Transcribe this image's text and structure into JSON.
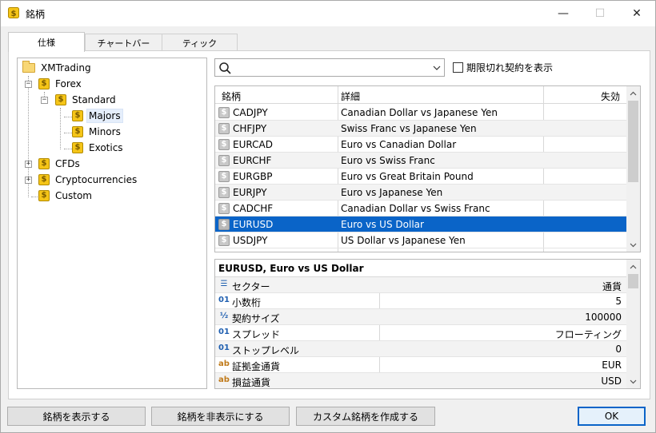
{
  "window": {
    "title": "銘柄",
    "minimize": "—",
    "maximize": "☐",
    "close": "✕"
  },
  "tabs": [
    {
      "label": "仕様",
      "active": true
    },
    {
      "label": "チャートバー",
      "active": false
    },
    {
      "label": "ティック",
      "active": false
    }
  ],
  "tree": {
    "root": "XMTrading",
    "forex": "Forex",
    "standard": "Standard",
    "majors": "Majors",
    "minors": "Minors",
    "exotics": "Exotics",
    "cfds": "CFDs",
    "crypto": "Cryptocurrencies",
    "custom": "Custom",
    "expanded_glyph": "−",
    "collapsed_glyph": "+"
  },
  "search": {
    "value": "",
    "placeholder": ""
  },
  "show_expired": {
    "label": "期限切れ契約を表示",
    "checked": false
  },
  "symbols_table": {
    "headers": [
      "銘柄",
      "詳細",
      "失効"
    ],
    "icon_glyph": "$",
    "rows": [
      {
        "symbol": "CADJPY",
        "description": "Canadian Dollar vs Japanese Yen",
        "expiration": ""
      },
      {
        "symbol": "CHFJPY",
        "description": "Swiss Franc vs Japanese Yen",
        "expiration": ""
      },
      {
        "symbol": "EURCAD",
        "description": "Euro vs Canadian Dollar",
        "expiration": ""
      },
      {
        "symbol": "EURCHF",
        "description": "Euro vs Swiss Franc",
        "expiration": ""
      },
      {
        "symbol": "EURGBP",
        "description": "Euro vs Great Britain Pound",
        "expiration": ""
      },
      {
        "symbol": "EURJPY",
        "description": "Euro vs Japanese Yen",
        "expiration": ""
      },
      {
        "symbol": "CADCHF",
        "description": "Canadian Dollar vs Swiss Franc",
        "expiration": ""
      },
      {
        "symbol": "EURUSD",
        "description": "Euro vs US Dollar",
        "expiration": ""
      },
      {
        "symbol": "USDJPY",
        "description": "US Dollar vs Japanese Yen",
        "expiration": ""
      }
    ],
    "selected_symbol": "EURUSD"
  },
  "details": {
    "title": "EURUSD, Euro vs US Dollar",
    "rows": [
      {
        "icon": "sector-icon",
        "glyph": "☰",
        "name": "セクター",
        "value": "通貨"
      },
      {
        "icon": "digits-icon",
        "glyph": "01",
        "name": "小数桁",
        "value": "5"
      },
      {
        "icon": "fraction-icon",
        "glyph": "½",
        "name": "契約サイズ",
        "value": "100000"
      },
      {
        "icon": "digits-icon",
        "glyph": "01",
        "name": "スプレッド",
        "value": "フローティング"
      },
      {
        "icon": "digits-icon",
        "glyph": "01",
        "name": "ストップレベル",
        "value": "0"
      },
      {
        "icon": "text-icon",
        "glyph": "ab",
        "name": "証拠金通貨",
        "value": "EUR"
      },
      {
        "icon": "text-icon",
        "glyph": "ab",
        "name": "損益通貨",
        "value": "USD"
      }
    ]
  },
  "buttons": {
    "show": "銘柄を表示する",
    "hide": "銘柄を非表示にする",
    "create_custom": "カスタム銘柄を作成する",
    "ok": "OK"
  },
  "colors": {
    "selection": "#0a64c8",
    "coin": "#f5c518",
    "folder": "#f8d775"
  }
}
